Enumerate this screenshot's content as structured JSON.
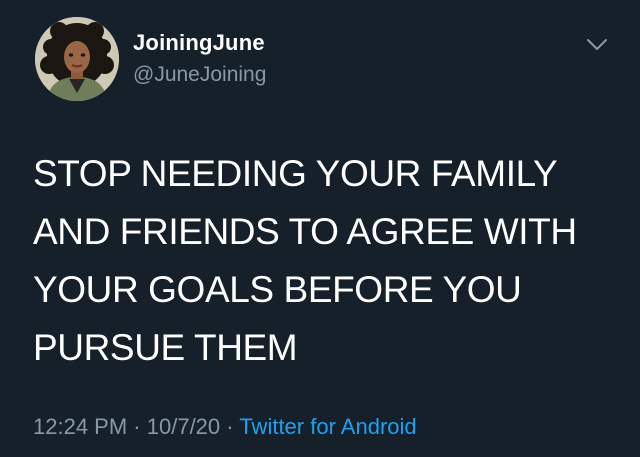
{
  "user": {
    "display_name": "JoiningJune",
    "handle": "@JuneJoining"
  },
  "tweet": {
    "text_lines": [
      "STOP NEEDING YOUR FAMILY",
      "AND FRIENDS TO AGREE WITH",
      "YOUR GOALS BEFORE YOU",
      "PURSUE THEM"
    ],
    "time": "12:24 PM",
    "date": "10/7/20",
    "separator": "·",
    "source": "Twitter for Android"
  },
  "icons": {
    "more_menu": "chevron-down-icon",
    "avatar": "avatar"
  },
  "colors": {
    "background": "#15202b",
    "primary_text": "#ffffff",
    "secondary_text": "#8899a6",
    "link": "#1da1f2"
  }
}
